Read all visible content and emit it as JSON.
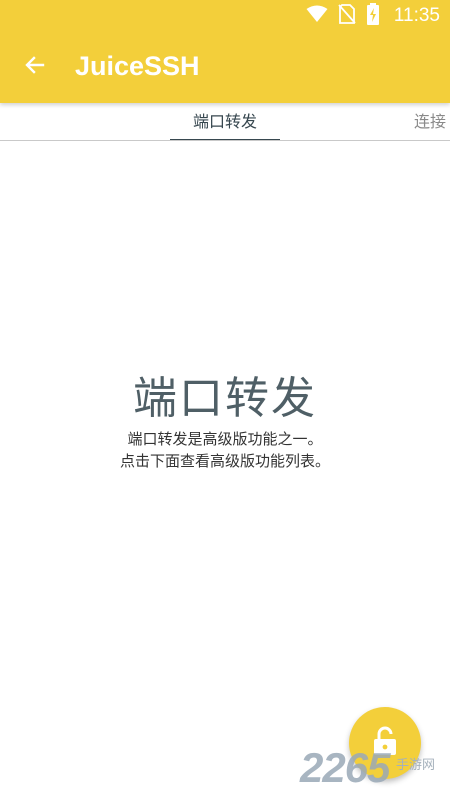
{
  "status_bar": {
    "time": "11:35",
    "icons": [
      "wifi-icon",
      "no-sim-icon",
      "battery-charging-icon"
    ]
  },
  "toolbar": {
    "back_icon": "arrow-left-icon",
    "title": "JuiceSSH"
  },
  "tabs": [
    {
      "label": "端口转发",
      "active": true
    },
    {
      "label": "连接",
      "active": false
    }
  ],
  "empty_state": {
    "title": "端口转发",
    "line1": "端口转发是高级版功能之一。",
    "line2": "点击下面查看高级版功能列表。"
  },
  "fab": {
    "icon": "unlock-icon",
    "color": "#f3cf3a"
  },
  "watermark": {
    "number": "2265",
    "text": "手游网"
  },
  "colors": {
    "appbar": "#f3cf3a",
    "tab_active": "#37474f",
    "tab_inactive": "#8a8a8a",
    "empty_title": "#4f5f66"
  }
}
